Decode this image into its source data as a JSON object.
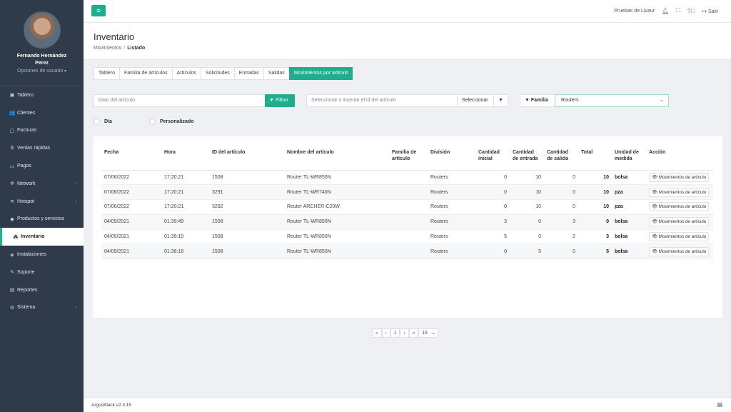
{
  "user": {
    "name": "Fernando Hernández Perez",
    "options": "Opciones de usuario"
  },
  "sidebar": {
    "items": [
      {
        "label": "Tablero",
        "icon": "dashboard-icon",
        "glyph": "▣",
        "caret": false
      },
      {
        "label": "Clientes",
        "icon": "users-icon",
        "glyph": "👥",
        "caret": false
      },
      {
        "label": "Facturas",
        "icon": "file-icon",
        "glyph": "▢",
        "caret": false
      },
      {
        "label": "Ventas rápidas",
        "icon": "dollar-icon",
        "glyph": "$",
        "caret": false
      },
      {
        "label": "Pagos",
        "icon": "money-icon",
        "glyph": "▭",
        "caret": false
      },
      {
        "label": "Network",
        "icon": "network-icon",
        "glyph": "✲",
        "caret": true
      },
      {
        "label": "Hotspot",
        "icon": "wifi-icon",
        "glyph": "≋",
        "caret": true
      },
      {
        "label": "Productos y servicios",
        "icon": "tag-icon",
        "glyph": "◆",
        "caret": false
      },
      {
        "label": "Inventario",
        "icon": "cubes-icon",
        "glyph": "⁂",
        "caret": false,
        "active": true
      },
      {
        "label": "Instalaciones",
        "icon": "tools-icon",
        "glyph": "◈",
        "caret": false
      },
      {
        "label": "Soporte",
        "icon": "wrench-icon",
        "glyph": "✎",
        "caret": false
      },
      {
        "label": "Reportes",
        "icon": "book-icon",
        "glyph": "▤",
        "caret": false
      },
      {
        "label": "Sistema",
        "icon": "cogs-icon",
        "glyph": "⚙",
        "caret": true
      }
    ]
  },
  "topbar": {
    "account": "Pruebas de Livaur",
    "logout": "Salir"
  },
  "page": {
    "title": "Inventario",
    "breadcrumb_parent": "Movimientos",
    "breadcrumb_current": "Listado"
  },
  "tabs": [
    "Tablero",
    "Familia de artículos",
    "Artículos",
    "Solicitudes",
    "Entradas",
    "Salidas",
    "Movimientos por artículo"
  ],
  "filters": {
    "item_placeholder": "Dato del artículo",
    "filter_button": "Filtrar",
    "id_placeholder": "Seleccionar o insertar él id del artículo",
    "select_button": "Seleccionar",
    "family_label": "Familia",
    "family_value": "Routers"
  },
  "radios": [
    "Día",
    "Personalizado"
  ],
  "table": {
    "headers": [
      "Fecha",
      "Hora",
      "ID del artículo",
      "Nombre del artículo",
      "Familia de artículo",
      "División",
      "Cantidad inicial",
      "Cantidad de entrada",
      "Cantidad de salida",
      "Total",
      "Unidad de medida",
      "Acción"
    ],
    "action_label": "Movimientos de artículo",
    "rows": [
      {
        "fecha": "07/06/2022",
        "hora": "17:20:21",
        "id": "1508",
        "nombre": "Router TL-WR850N",
        "familia": "",
        "division": "Routers",
        "inicial": "0",
        "entrada": "10",
        "salida": "0",
        "total": "10",
        "unidad": "bolsa"
      },
      {
        "fecha": "07/06/2022",
        "hora": "17:20:21",
        "id": "3291",
        "nombre": "Router TL-WR740N",
        "familia": "",
        "division": "Routers",
        "inicial": "0",
        "entrada": "10",
        "salida": "0",
        "total": "10",
        "unidad": "pza"
      },
      {
        "fecha": "07/06/2022",
        "hora": "17:20:21",
        "id": "3292",
        "nombre": "Router ARCHER-C20W",
        "familia": "",
        "division": "Routers",
        "inicial": "0",
        "entrada": "10",
        "salida": "0",
        "total": "10",
        "unidad": "pza"
      },
      {
        "fecha": "04/09/2021",
        "hora": "01:39:49",
        "id": "1508",
        "nombre": "Router TL-WR850N",
        "familia": "",
        "division": "Routers",
        "inicial": "3",
        "entrada": "0",
        "salida": "3",
        "total": "0",
        "unidad": "bolsa"
      },
      {
        "fecha": "04/09/2021",
        "hora": "01:39:10",
        "id": "1508",
        "nombre": "Router TL-WR850N",
        "familia": "",
        "division": "Routers",
        "inicial": "5",
        "entrada": "0",
        "salida": "2",
        "total": "3",
        "unidad": "bolsa"
      },
      {
        "fecha": "04/09/2021",
        "hora": "01:38:16",
        "id": "1508",
        "nombre": "Router TL-WR850N",
        "familia": "",
        "division": "Routers",
        "inicial": "0",
        "entrada": "5",
        "salida": "0",
        "total": "5",
        "unidad": "bolsa"
      }
    ]
  },
  "pagination": {
    "first": "«",
    "prev": "‹",
    "page": "1",
    "next": "›",
    "last": "»",
    "per_page": "10"
  },
  "footer": {
    "version": "ArgusBlack v2.3.15"
  },
  "colors": {
    "accent": "#1fae8b",
    "sidebar": "#2f3b4a"
  }
}
